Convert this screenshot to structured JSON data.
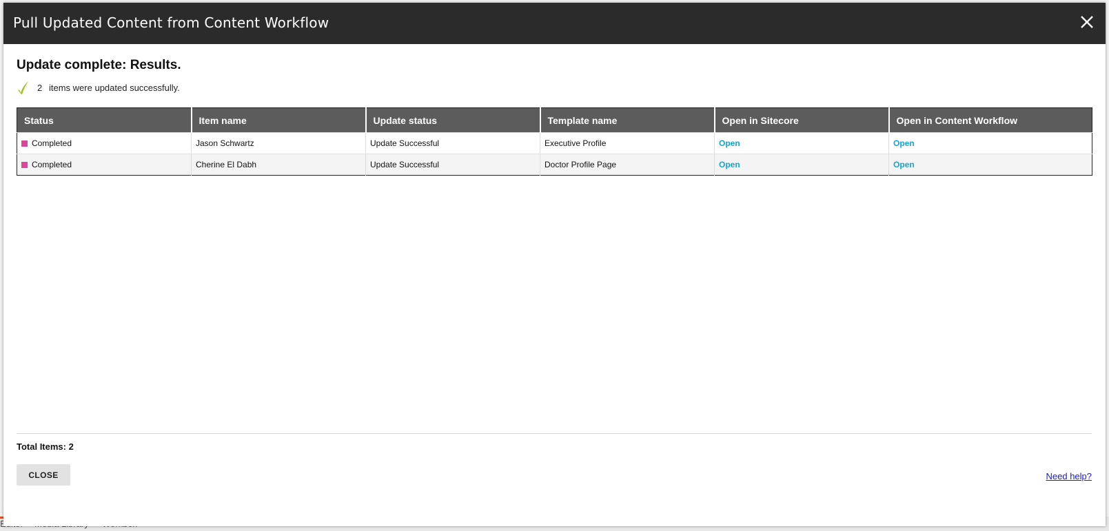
{
  "background": {
    "tabs": [
      "Editor",
      "Media Library",
      "Workbox"
    ],
    "accent_color": "#d9532c"
  },
  "dialog": {
    "title": "Pull Updated Content from Content Workflow",
    "close_icon": "close-icon",
    "heading": "Update complete: Results.",
    "summary": {
      "icon": "checkmark-icon",
      "count": "2",
      "text": "items were updated successfully."
    },
    "table": {
      "columns": [
        "Status",
        "Item name",
        "Update status",
        "Template name",
        "Open in Sitecore",
        "Open in Content Workflow"
      ],
      "rows": [
        {
          "status": "Completed",
          "item_name": "Jason Schwartz",
          "update_status": "Update Successful",
          "template_name": "Executive Profile",
          "open_sitecore": "Open",
          "open_workflow": "Open"
        },
        {
          "status": "Completed",
          "item_name": "Cherine El Dabh",
          "update_status": "Update Successful",
          "template_name": "Doctor Profile Page",
          "open_sitecore": "Open",
          "open_workflow": "Open"
        }
      ]
    },
    "total_label": "Total Items: 2",
    "close_button": "CLOSE",
    "help_link": "Need help?",
    "colors": {
      "header_bg": "#2b2b2b",
      "table_header_bg": "#5c5c5c",
      "status_square": "#e0449a",
      "success_text": "#2a8a2a",
      "link": "#16a3d6",
      "check": "#9bc31e"
    }
  }
}
